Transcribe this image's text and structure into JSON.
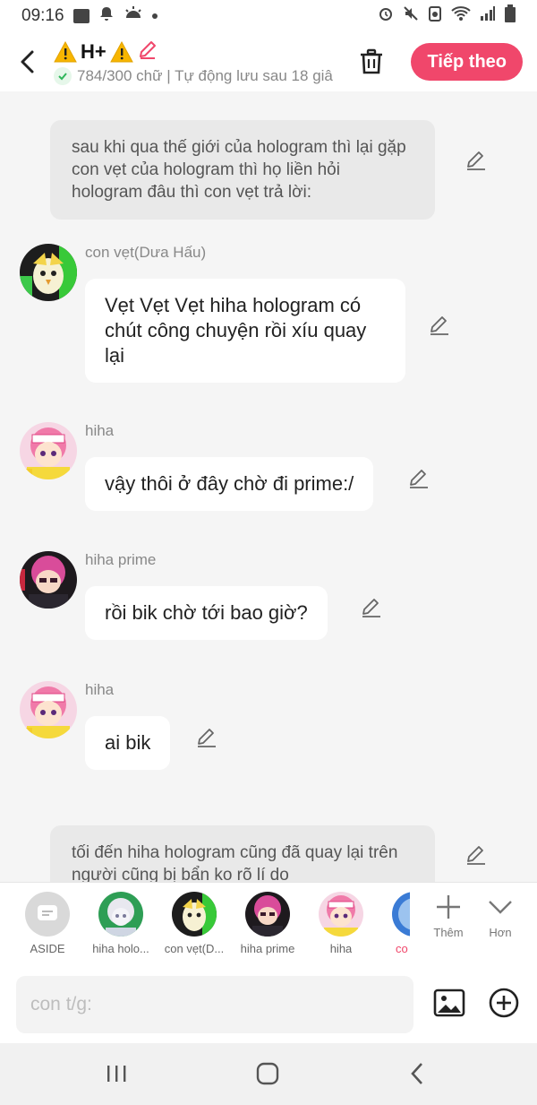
{
  "status_bar": {
    "time": "09:16"
  },
  "header": {
    "title": "H+",
    "subtitle": "784/300 chữ | Tự động lưu sau 18 giâ",
    "next_label": "Tiếp theo"
  },
  "chat": {
    "aside_1": "sau khi qua thế giới của hologram thì lại gặp con vẹt của hologram thì họ liền hỏi hologram đâu thì con vẹt trả lời:",
    "messages": [
      {
        "speaker": "con vẹt(Dưa Hấu)",
        "text": "Vẹt Vẹt Vẹt hiha hologram có chút công chuyện rồi xíu quay lại"
      },
      {
        "speaker": "hiha",
        "text": "vậy thôi ở đây chờ đi prime:/"
      },
      {
        "speaker": "hiha prime",
        "text": "rồi bik chờ tới bao giờ?"
      },
      {
        "speaker": "hiha",
        "text": "ai bik"
      }
    ],
    "aside_2": "tối đến hiha hologram cũng đã quay lại trên người cũng bị bẩn ko rõ lí do"
  },
  "characters": [
    {
      "label": "ASIDE"
    },
    {
      "label": "hiha holo..."
    },
    {
      "label": "con vẹt(D..."
    },
    {
      "label": "hiha prime"
    },
    {
      "label": "hiha"
    },
    {
      "label": "co"
    }
  ],
  "tools": {
    "add_label": "Thêm",
    "more_label": "Hơn"
  },
  "input": {
    "placeholder": "con t/g:"
  },
  "colors": {
    "accent": "#f0476b",
    "aside_bg": "#e9e9e9",
    "page_bg": "#f5f5f5"
  }
}
